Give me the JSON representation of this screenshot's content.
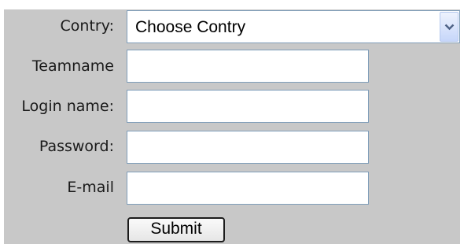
{
  "form": {
    "country": {
      "label": "Contry:",
      "selected": "Choose Contry"
    },
    "teamname": {
      "label": "Teamname",
      "value": ""
    },
    "login": {
      "label": "Login name:",
      "value": ""
    },
    "password": {
      "label": "Password:",
      "value": ""
    },
    "email": {
      "label": "E-mail",
      "value": ""
    },
    "submit_label": "Submit"
  },
  "icons": {
    "dropdown": "chevron-down-icon"
  }
}
